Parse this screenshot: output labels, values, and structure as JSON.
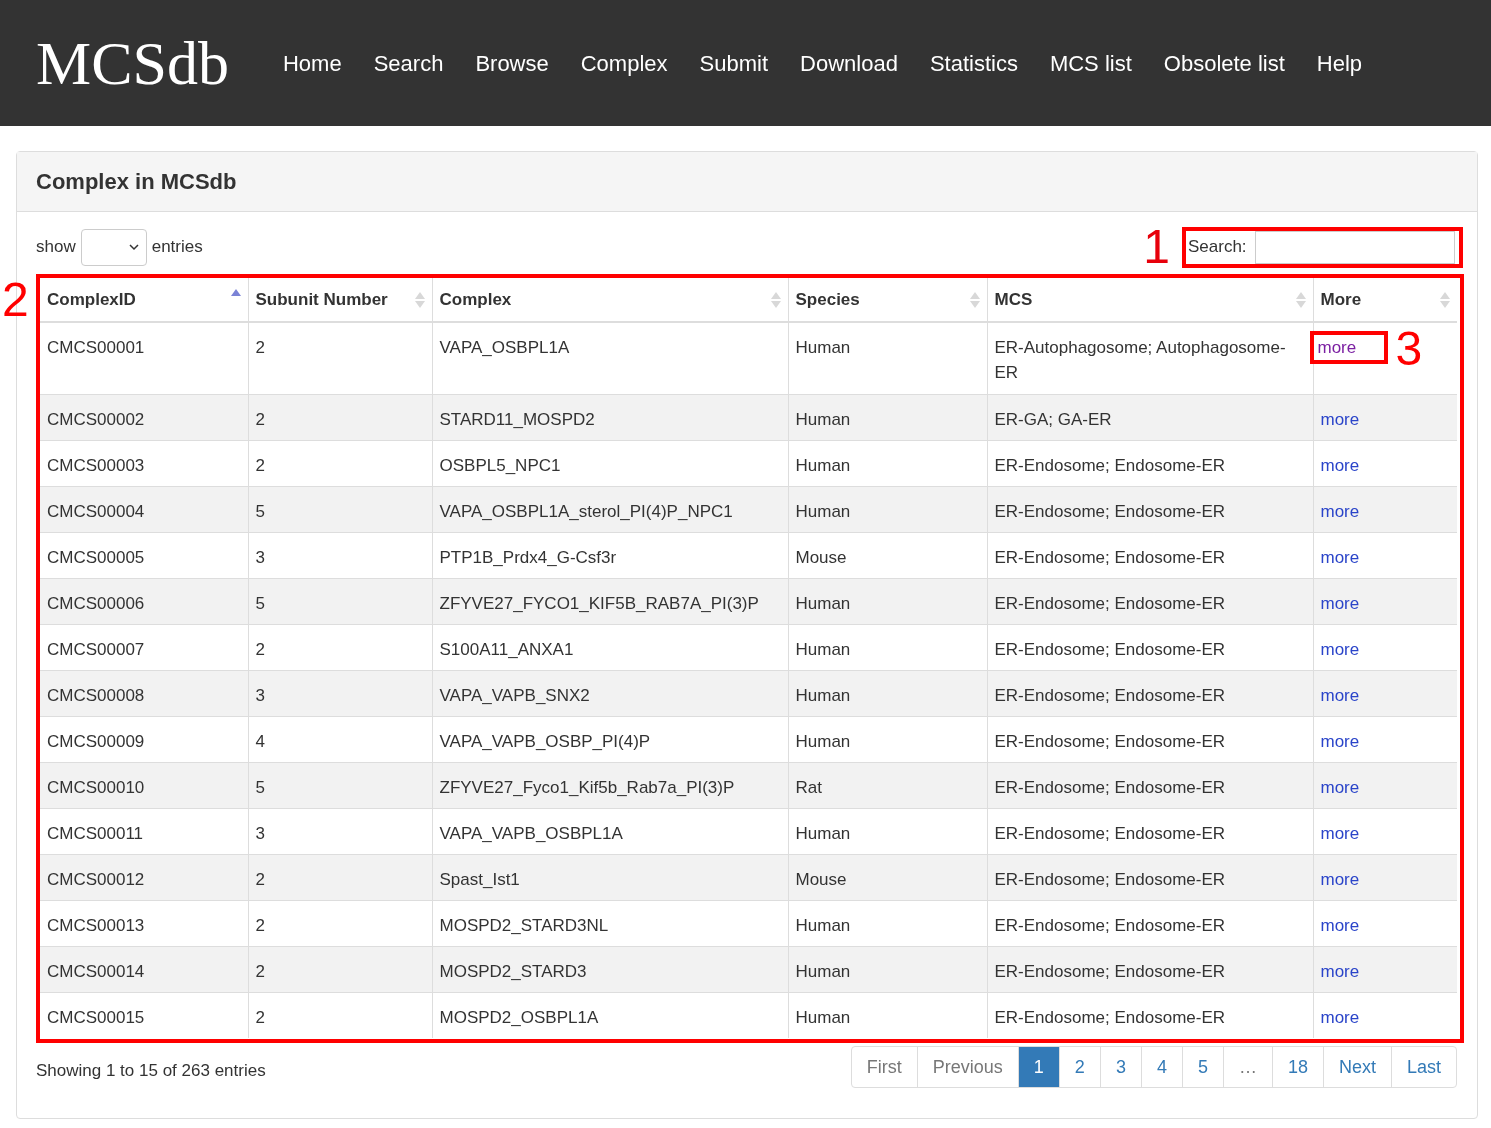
{
  "navbar": {
    "logo": "MCSdb",
    "items": [
      "Home",
      "Search",
      "Browse",
      "Complex",
      "Submit",
      "Download",
      "Statistics",
      "MCS list",
      "Obsolete list",
      "Help"
    ]
  },
  "panel": {
    "title": "Complex in MCSdb"
  },
  "length_menu": {
    "before": "show",
    "after": "entries"
  },
  "search": {
    "label": "Search:"
  },
  "annotations": {
    "search": "1",
    "table": "2",
    "more_link": "3"
  },
  "table": {
    "columns": [
      {
        "label": "ComplexID",
        "sorted": true
      },
      {
        "label": "Subunit Number",
        "sorted": false
      },
      {
        "label": "Complex",
        "sorted": false
      },
      {
        "label": "Species",
        "sorted": false
      },
      {
        "label": "MCS",
        "sorted": false
      },
      {
        "label": "More",
        "sorted": false
      }
    ],
    "rows": [
      {
        "id": "CMCS00001",
        "subunits": "2",
        "complex": "VAPA_OSBPL1A",
        "species": "Human",
        "mcs": "ER-Autophagosome; Autophagosome-ER",
        "more": "more",
        "visited": true
      },
      {
        "id": "CMCS00002",
        "subunits": "2",
        "complex": "STARD11_MOSPD2",
        "species": "Human",
        "mcs": "ER-GA; GA-ER",
        "more": "more",
        "visited": false
      },
      {
        "id": "CMCS00003",
        "subunits": "2",
        "complex": "OSBPL5_NPC1",
        "species": "Human",
        "mcs": "ER-Endosome; Endosome-ER",
        "more": "more",
        "visited": false
      },
      {
        "id": "CMCS00004",
        "subunits": "5",
        "complex": "VAPA_OSBPL1A_sterol_PI(4)P_NPC1",
        "species": "Human",
        "mcs": "ER-Endosome; Endosome-ER",
        "more": "more",
        "visited": false
      },
      {
        "id": "CMCS00005",
        "subunits": "3",
        "complex": "PTP1B_Prdx4_G-Csf3r",
        "species": "Mouse",
        "mcs": "ER-Endosome; Endosome-ER",
        "more": "more",
        "visited": false
      },
      {
        "id": "CMCS00006",
        "subunits": "5",
        "complex": "ZFYVE27_FYCO1_KIF5B_RAB7A_PI(3)P",
        "species": "Human",
        "mcs": "ER-Endosome; Endosome-ER",
        "more": "more",
        "visited": false
      },
      {
        "id": "CMCS00007",
        "subunits": "2",
        "complex": "S100A11_ANXA1",
        "species": "Human",
        "mcs": "ER-Endosome; Endosome-ER",
        "more": "more",
        "visited": false
      },
      {
        "id": "CMCS00008",
        "subunits": "3",
        "complex": "VAPA_VAPB_SNX2",
        "species": "Human",
        "mcs": "ER-Endosome; Endosome-ER",
        "more": "more",
        "visited": false
      },
      {
        "id": "CMCS00009",
        "subunits": "4",
        "complex": "VAPA_VAPB_OSBP_PI(4)P",
        "species": "Human",
        "mcs": "ER-Endosome; Endosome-ER",
        "more": "more",
        "visited": false
      },
      {
        "id": "CMCS00010",
        "subunits": "5",
        "complex": "ZFYVE27_Fyco1_Kif5b_Rab7a_PI(3)P",
        "species": "Rat",
        "mcs": "ER-Endosome; Endosome-ER",
        "more": "more",
        "visited": false
      },
      {
        "id": "CMCS00011",
        "subunits": "3",
        "complex": "VAPA_VAPB_OSBPL1A",
        "species": "Human",
        "mcs": "ER-Endosome; Endosome-ER",
        "more": "more",
        "visited": false
      },
      {
        "id": "CMCS00012",
        "subunits": "2",
        "complex": "Spast_Ist1",
        "species": "Mouse",
        "mcs": "ER-Endosome; Endosome-ER",
        "more": "more",
        "visited": false
      },
      {
        "id": "CMCS00013",
        "subunits": "2",
        "complex": "MOSPD2_STARD3NL",
        "species": "Human",
        "mcs": "ER-Endosome; Endosome-ER",
        "more": "more",
        "visited": false
      },
      {
        "id": "CMCS00014",
        "subunits": "2",
        "complex": "MOSPD2_STARD3",
        "species": "Human",
        "mcs": "ER-Endosome; Endosome-ER",
        "more": "more",
        "visited": false
      },
      {
        "id": "CMCS00015",
        "subunits": "2",
        "complex": "MOSPD2_OSBPL1A",
        "species": "Human",
        "mcs": "ER-Endosome; Endosome-ER",
        "more": "more",
        "visited": false
      }
    ]
  },
  "info": "Showing 1 to 15 of 263 entries",
  "pagination": [
    {
      "label": "First",
      "selected": false,
      "disabled": true
    },
    {
      "label": "Previous",
      "selected": false,
      "disabled": true
    },
    {
      "label": "1",
      "selected": true,
      "disabled": false
    },
    {
      "label": "2",
      "selected": false,
      "disabled": false
    },
    {
      "label": "3",
      "selected": false,
      "disabled": false
    },
    {
      "label": "4",
      "selected": false,
      "disabled": false
    },
    {
      "label": "5",
      "selected": false,
      "disabled": false
    },
    {
      "label": "…",
      "selected": false,
      "disabled": true
    },
    {
      "label": "18",
      "selected": false,
      "disabled": false
    },
    {
      "label": "Next",
      "selected": false,
      "disabled": false
    },
    {
      "label": "Last",
      "selected": false,
      "disabled": false
    }
  ]
}
